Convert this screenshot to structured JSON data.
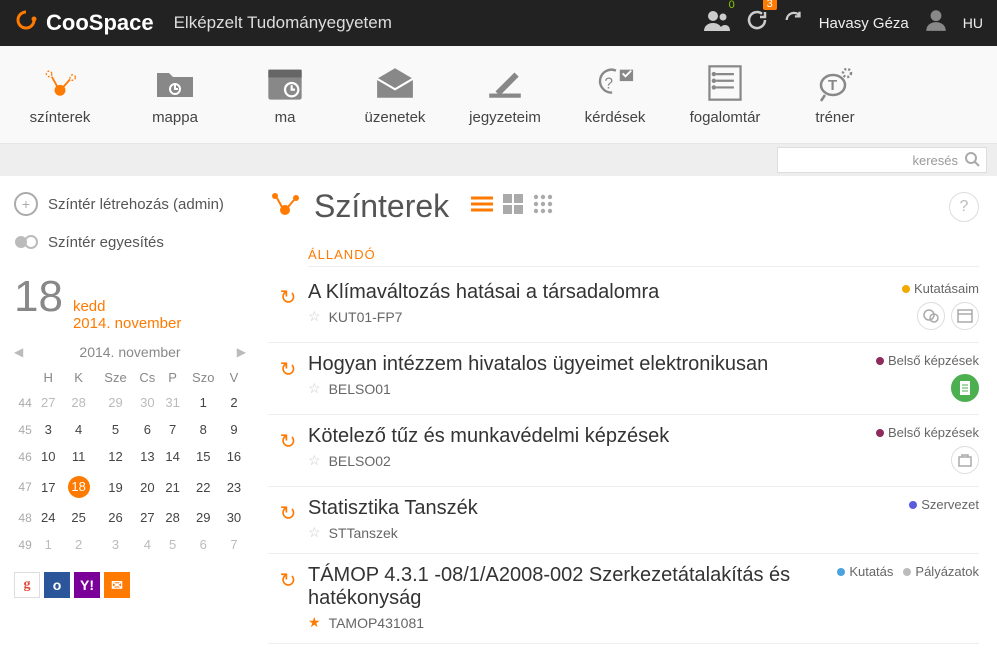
{
  "top": {
    "brand": "CooSpace",
    "org": "Elképzelt Tudományegyetem",
    "people_badge": "0",
    "refresh_badge": "3",
    "user": "Havasy Géza",
    "lang": "HU"
  },
  "nav": [
    {
      "label": "színterek"
    },
    {
      "label": "mappa"
    },
    {
      "label": "ma"
    },
    {
      "label": "üzenetek"
    },
    {
      "label": "jegyzeteim"
    },
    {
      "label": "kérdések"
    },
    {
      "label": "fogalomtár"
    },
    {
      "label": "tréner"
    }
  ],
  "search": {
    "placeholder": "keresés"
  },
  "side": {
    "create": "Színtér létrehozás (admin)",
    "merge": "Színtér egyesítés",
    "daynum": "18",
    "dayname": "kedd",
    "date": "2014. november",
    "month_label": "2014. november",
    "dow": [
      "H",
      "K",
      "Sze",
      "Cs",
      "P",
      "Szo",
      "V"
    ],
    "weeks": [
      {
        "wk": "44",
        "d": [
          "27",
          "28",
          "29",
          "30",
          "31",
          "1",
          "2"
        ],
        "dim": [
          0,
          1,
          2,
          3,
          4
        ]
      },
      {
        "wk": "45",
        "d": [
          "3",
          "4",
          "5",
          "6",
          "7",
          "8",
          "9"
        ]
      },
      {
        "wk": "46",
        "d": [
          "10",
          "11",
          "12",
          "13",
          "14",
          "15",
          "16"
        ]
      },
      {
        "wk": "47",
        "d": [
          "17",
          "18",
          "19",
          "20",
          "21",
          "22",
          "23"
        ],
        "today": 1
      },
      {
        "wk": "48",
        "d": [
          "24",
          "25",
          "26",
          "27",
          "28",
          "29",
          "30"
        ]
      },
      {
        "wk": "49",
        "d": [
          "1",
          "2",
          "3",
          "4",
          "5",
          "6",
          "7"
        ],
        "dim": [
          0,
          1,
          2,
          3,
          4,
          5,
          6
        ]
      }
    ]
  },
  "main": {
    "title": "Színterek",
    "section": "ÁLLANDÓ",
    "items": [
      {
        "title": "A Klímaváltozás hatásai a társadalomra",
        "code": "KUT01-FP7",
        "starred": false,
        "tags": [
          {
            "color": "#f2a900",
            "label": "Kutatásaim"
          }
        ],
        "chips": [
          "chat",
          "card"
        ]
      },
      {
        "title": "Hogyan intézzem hivatalos ügyeimet elektronikusan",
        "code": "BELSO01",
        "starred": false,
        "tags": [
          {
            "color": "#8a2d5a",
            "label": "Belső képzések"
          }
        ],
        "chips": [
          "doc-green"
        ]
      },
      {
        "title": "Kötelező tűz és munkavédelmi képzések",
        "code": "BELSO02",
        "starred": false,
        "tags": [
          {
            "color": "#8a2d5a",
            "label": "Belső képzések"
          }
        ],
        "chips": [
          "box"
        ]
      },
      {
        "title": "Statisztika Tanszék",
        "code": "STTanszek",
        "starred": false,
        "tags": [
          {
            "color": "#5a5adf",
            "label": "Szervezet"
          }
        ],
        "chips": []
      },
      {
        "title": "TÁMOP 4.3.1 -08/1/A2008-002 Szerkezetátalakítás és hatékonyság",
        "code": "TAMOP431081",
        "starred": true,
        "tags": [
          {
            "color": "#4aa3df",
            "label": "Kutatás"
          },
          {
            "color": "#bbbbbb",
            "label": "Pályázatok"
          }
        ],
        "chips": []
      }
    ]
  }
}
